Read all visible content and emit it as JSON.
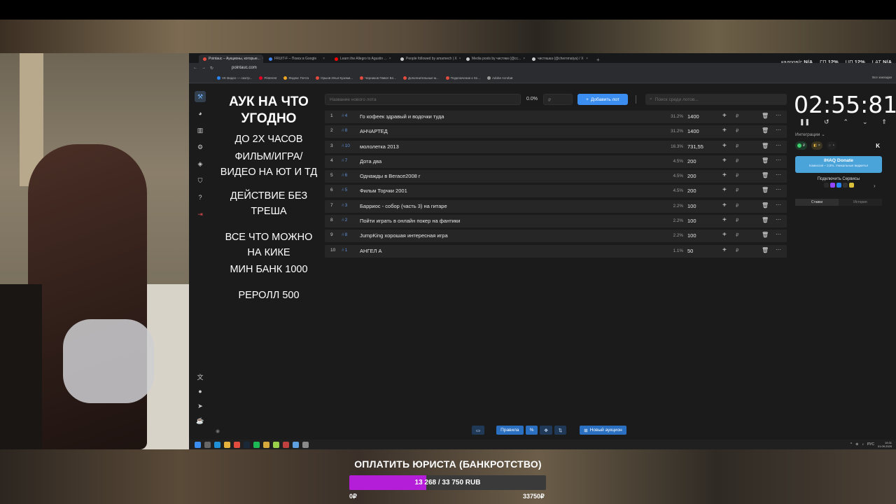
{
  "browser": {
    "tabs": [
      {
        "label": "Pointauc – Аукционы, которые...",
        "active": true,
        "color": "#e24c3f"
      },
      {
        "label": "FRUIT-F – Поиск в Google",
        "active": false,
        "color": "#4285f4"
      },
      {
        "label": "Learn the Allegro to Agustin ...",
        "active": false,
        "color": "#ff0000"
      },
      {
        "label": "People followed by amamech | X",
        "active": false,
        "color": "#cccccc"
      },
      {
        "label": "Media posts by чистяки (@сс...",
        "active": false,
        "color": "#cccccc"
      },
      {
        "label": "чистяшка (@chernmatya) / X",
        "active": false,
        "color": "#cccccc"
      }
    ],
    "new_tab": "+",
    "url": "pointauc.com",
    "bookmarks": [
      {
        "label": "VK Видео — смотр...",
        "color": "#2787f5"
      },
      {
        "label": "Pinterest",
        "color": "#e60023"
      },
      {
        "label": "Яндекс Почта",
        "color": "#f5a623"
      },
      {
        "label": "Орыов Илья Куземи...",
        "color": "#e24c3f"
      },
      {
        "label": "Черников Павел Вл...",
        "color": "#e24c3f"
      },
      {
        "label": "Дополнительные м...",
        "color": "#e24c3f"
      },
      {
        "label": "Подключение к Sn...",
        "color": "#e24c3f"
      },
      {
        "label": "Adobe Acrobat",
        "color": "#999999"
      }
    ],
    "all_bookmarks": "Все закладки"
  },
  "overlay_stats": {
    "frames_label": "кадров/с",
    "frames": "N/A",
    "gpu_label": "ГП",
    "gpu": "12",
    "cpu_label": "ЦП",
    "cpu": "12",
    "lat_label": "LAT",
    "lat": "N/A"
  },
  "rules": {
    "title": "АУК НА ЧТО УГОДНО",
    "lines": [
      "ДО 2Х ЧАСОВ",
      "ФИЛЬМ/ИГРА/",
      "ВИДЕО НА ЮТ И ТД",
      "ДЕЙСТВИЕ БЕЗ",
      "ТРЕША",
      "ВСЕ ЧТО МОЖНО",
      "НА КИКЕ",
      "МИН БАНК 1000",
      "РЕРОЛЛ 500"
    ]
  },
  "topbar": {
    "lot_placeholder": "Название нового лота",
    "pct": "0.0%",
    "amount_placeholder": "₽",
    "add_button": "Добавить лот",
    "search_placeholder": "Поиск среди лотов..."
  },
  "lots": [
    {
      "idx": "1",
      "id": "4",
      "name": "Го кофеек здравый и водочки туда",
      "pct": "31.2%",
      "amount": "1400"
    },
    {
      "idx": "2",
      "id": "8",
      "name": "АНЧАРТЕД",
      "pct": "31.2%",
      "amount": "1400"
    },
    {
      "idx": "3",
      "id": "10",
      "name": "мололетка 2013",
      "pct": "16.3%",
      "amount": "731,55"
    },
    {
      "idx": "4",
      "id": "7",
      "name": "Дота два",
      "pct": "4.5%",
      "amount": "200"
    },
    {
      "idx": "5",
      "id": "6",
      "name": "Однажды в Вегасе2008 г",
      "pct": "4.5%",
      "amount": "200"
    },
    {
      "idx": "6",
      "id": "5",
      "name": "Фильм Торчки 2001",
      "pct": "4.5%",
      "amount": "200"
    },
    {
      "idx": "7",
      "id": "3",
      "name": "Барриос - собор (часть 3) на гитаре",
      "pct": "2.2%",
      "amount": "100"
    },
    {
      "idx": "8",
      "id": "2",
      "name": "Пойти играть в онлайн покер на фантики",
      "pct": "2.2%",
      "amount": "100"
    },
    {
      "idx": "9",
      "id": "8",
      "name": "JumpKing хорошая интересная игра",
      "pct": "2.2%",
      "amount": "100"
    },
    {
      "idx": "10",
      "id": "1",
      "name": "АНГЕЛ А",
      "pct": "1.1%",
      "amount": "50"
    }
  ],
  "row_symbols": {
    "plus": "+",
    "rub": "₽",
    "del": "🗑",
    "more": "···",
    "hash": "#"
  },
  "right_panel": {
    "timer": "02:55:81",
    "integrations_label": "Интеграции",
    "donate_title": "IHAQ Donate",
    "donate_sub": "Комиссия – 3,5%. Уникальные виджеты!",
    "connect_label": "Подключить Сервисы",
    "tab_bets": "Ставки",
    "tab_history": "История"
  },
  "bottom_toolbar": {
    "rules_label": "Правила",
    "new_auction_label": "Новый аукцион"
  },
  "taskbar": {
    "lang": "РУС",
    "time": "19:31",
    "date": "01.09.2025"
  },
  "stream_goal": {
    "title": "ОПЛАТИТЬ ЮРИСТА (БАНКРОТСТВО)",
    "progress_text": "13 268 / 33 750 RUB",
    "current": 13268,
    "target": 33750,
    "min_label": "0₽",
    "max_label": "33750₽",
    "fill_color": "#b51ed9"
  }
}
